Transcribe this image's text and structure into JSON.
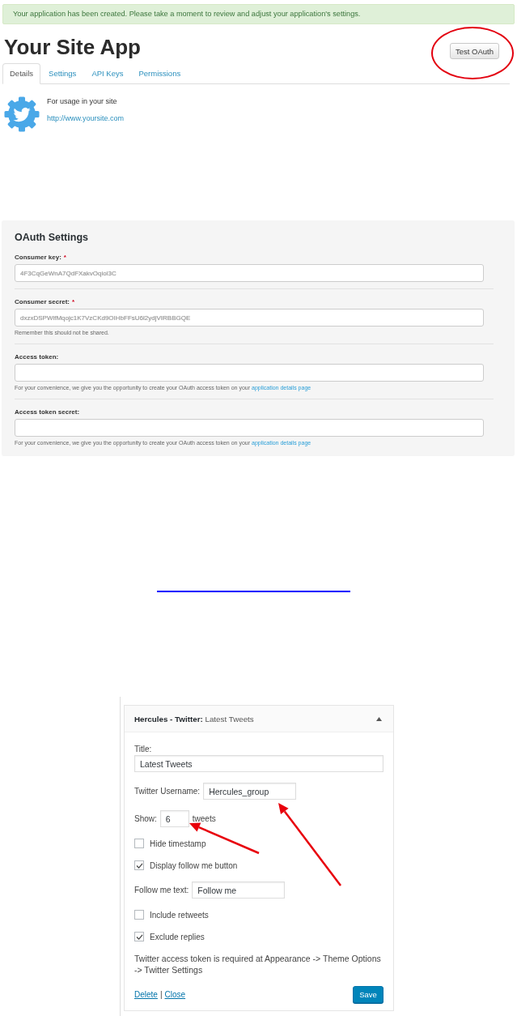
{
  "alert": "Your application has been created. Please take a moment to review and adjust your application's settings.",
  "header": {
    "title": "Your Site App",
    "button": {
      "label": "Test OAuth",
      "circled": true
    }
  },
  "tabs": [
    {
      "label": "Details",
      "selected": true
    },
    {
      "label": "Settings",
      "selected": false
    },
    {
      "label": "API Keys",
      "selected": false
    },
    {
      "label": "Permissions",
      "selected": false
    }
  ],
  "app_info": {
    "description": "For usage in your site",
    "url": "http://www.yoursite.com"
  },
  "oauth_settings": {
    "title": "OAuth Settings",
    "fields": [
      {
        "label": "Consumer key:",
        "required_mark": "*",
        "value": "4F3CqGeWnA7QdFXakvOqiol3C"
      },
      {
        "label": "Consumer secret:",
        "required_mark": "*",
        "value": "dxzxDSPWifMqojc1K7VzCKd9OIHbFFsU6l2ydjVIRBBGQE",
        "hint": "Remember this should not be shared."
      },
      {
        "label": "Access token:",
        "hint": "For your convenience, we give you the opportunity to create your OAuth access token on your",
        "hint_link": "application details page"
      },
      {
        "label": "Access token secret:",
        "hint": "For your convenience, we give you the opportunity to create your OAuth access token on your",
        "hint_link": "application details page"
      }
    ]
  },
  "widget": {
    "title": "**Hercules - Twitter:** Latest Tweets",
    "items": [
      {
        "kind": "stacked_field",
        "label": "Title:",
        "value": "Latest Tweets"
      },
      {
        "kind": "inline_field",
        "label": "Twitter Username:",
        "value": "Hercules_group"
      },
      {
        "kind": "inline_field",
        "label": "Show:",
        "value": "6",
        "suffix": "tweets"
      },
      {
        "kind": "checkbox",
        "label": "Hide timestamp",
        "checked": false
      },
      {
        "kind": "checkbox",
        "label": "Display follow me button",
        "checked": true
      },
      {
        "kind": "inline_field",
        "label": "Follow me text:",
        "value": "Follow me"
      },
      {
        "kind": "checkbox",
        "label": "Include retweets",
        "checked": false
      },
      {
        "kind": "checkbox",
        "label": "Exclude replies",
        "checked": true
      },
      {
        "kind": "note",
        "text": "Twitter access token is required at Appearance -> Theme Options -> Twitter Settings"
      }
    ],
    "links": [
      "Delete",
      "Close"
    ],
    "link_separator": "|",
    "save_button": "Save"
  }
}
